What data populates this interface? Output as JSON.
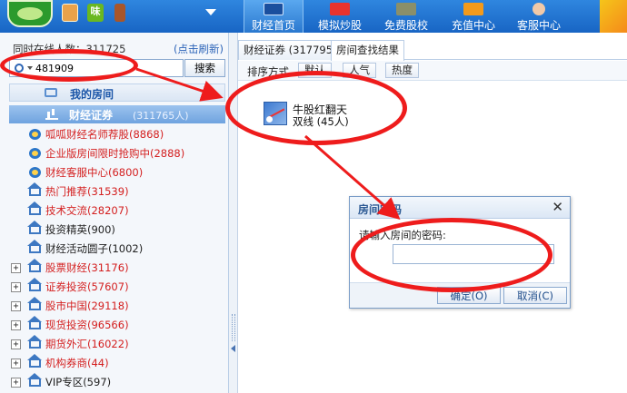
{
  "topbar": {
    "tab_badge": "味",
    "nav": [
      {
        "label": "财经首页"
      },
      {
        "label": "模拟炒股"
      },
      {
        "label": "免费股校"
      },
      {
        "label": "充值中心"
      },
      {
        "label": "客服中心"
      }
    ]
  },
  "sidebar": {
    "online_label": "同时在线人数：",
    "online_count": "311725",
    "refresh_link": "(点击刷新)",
    "search_value": "481909",
    "search_button": "搜索",
    "my_room": "我的房间",
    "category": "财经证券",
    "category_count": "(311765人)",
    "items": [
      {
        "label": "呱呱财经名师荐股(8868)",
        "color": "red",
        "icon": "ie-icon",
        "expandable": false
      },
      {
        "label": "企业版房间限时抢购中(2888)",
        "color": "red",
        "icon": "ie-icon",
        "expandable": false
      },
      {
        "label": "财经客服中心(6800)",
        "color": "red",
        "icon": "ie-icon",
        "expandable": false
      },
      {
        "label": "热门推荐(31539)",
        "color": "red",
        "icon": "house-icon",
        "expandable": false
      },
      {
        "label": "技术交流(28207)",
        "color": "red",
        "icon": "house-icon",
        "expandable": false
      },
      {
        "label": "投资精英(900)",
        "color": "dark",
        "icon": "house-icon",
        "expandable": false
      },
      {
        "label": "财经活动圆子(1002)",
        "color": "dark",
        "icon": "house-icon",
        "expandable": false
      },
      {
        "label": "股票财经(31176)",
        "color": "red",
        "icon": "house-icon",
        "expandable": true
      },
      {
        "label": "证券投资(57607)",
        "color": "red",
        "icon": "house-icon",
        "expandable": true
      },
      {
        "label": "股市中国(29118)",
        "color": "red",
        "icon": "house-icon",
        "expandable": true
      },
      {
        "label": "现货投资(96566)",
        "color": "red",
        "icon": "house-icon",
        "expandable": true
      },
      {
        "label": "期货外汇(16022)",
        "color": "red",
        "icon": "house-icon",
        "expandable": true
      },
      {
        "label": "机构券商(44)",
        "color": "red",
        "icon": "house-icon",
        "expandable": true
      },
      {
        "label": "VIP专区(597)",
        "color": "dark",
        "icon": "house-icon",
        "expandable": true
      }
    ]
  },
  "main": {
    "tabs": [
      {
        "label": "财经证券 (317795)"
      },
      {
        "label": "房间查找结果"
      }
    ],
    "sort_label": "排序方式",
    "sort_buttons": [
      {
        "label": "默认"
      },
      {
        "label": "人气"
      },
      {
        "label": "热度"
      }
    ],
    "room": {
      "name": "牛股红翻天",
      "subtitle": "双线 (45人)"
    }
  },
  "dialog": {
    "title": "房间密码",
    "prompt": "请输入房间的密码:",
    "password_value": "",
    "ok_button": "确定(O)",
    "cancel_button": "取消(C)"
  },
  "colors": {
    "topbar": "#1f72d0",
    "accent_red": "#d42020",
    "annotation_red": "#ee1c1c",
    "link_blue": "#2c64b8"
  }
}
